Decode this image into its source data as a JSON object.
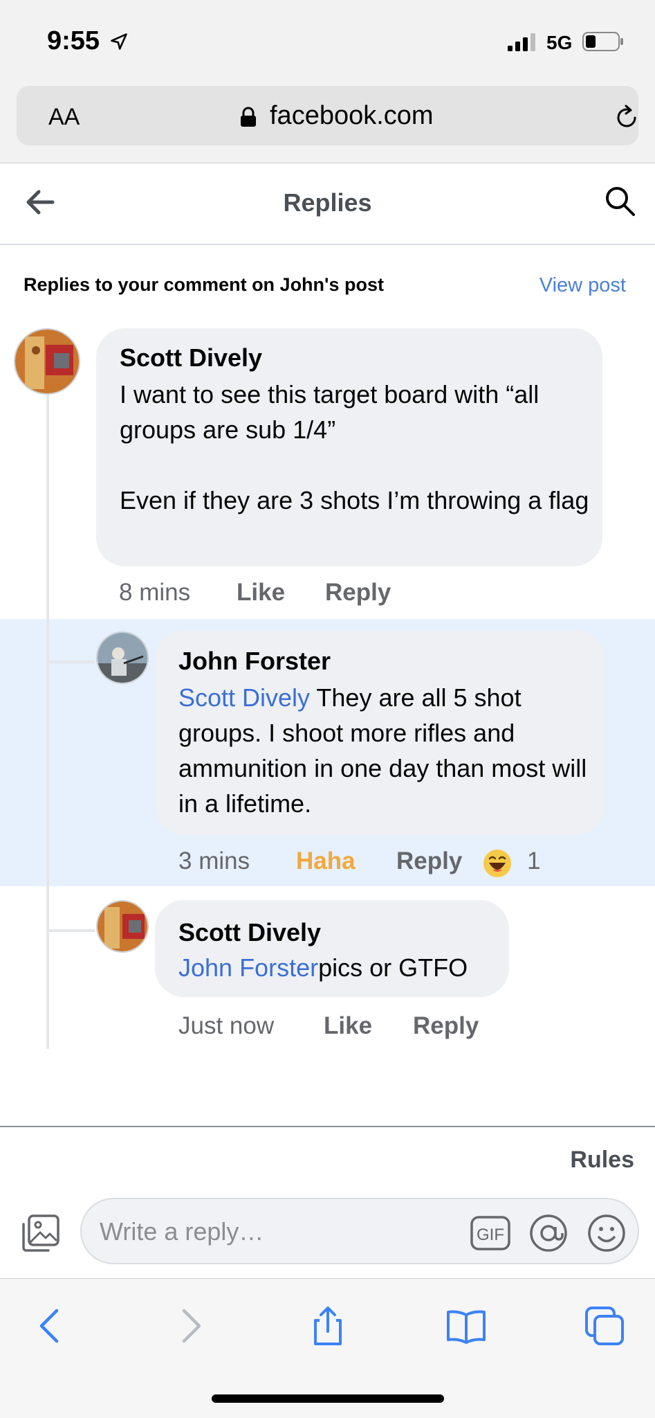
{
  "status_bar": {
    "time": "9:55",
    "network": "5G"
  },
  "browser": {
    "text_size_label": "AA",
    "url": "facebook.com"
  },
  "header": {
    "title": "Replies"
  },
  "subheader": {
    "text": "Replies to your comment on John's post",
    "view_post": "View post"
  },
  "comments": [
    {
      "author": "Scott Dively",
      "text": "I want to see this target board with “all groups are sub 1/4”\n\nEven if they are 3 shots I’m throwing a flag",
      "time": "8 mins",
      "like_label": "Like",
      "reply_label": "Reply"
    },
    {
      "author": "John Forster",
      "mention": "Scott Dively",
      "text": " They are all 5 shot groups. I shoot more rifles and ammunition in one day than most will in a lifetime.",
      "time": "3 mins",
      "reaction_label": "Haha",
      "reply_label": "Reply",
      "reaction_count": "1",
      "reaction_emoji": "haha-emoji"
    },
    {
      "author": "Scott Dively",
      "mention": "John Forster",
      "text": "pics or GTFO",
      "time": "Just now",
      "like_label": "Like",
      "reply_label": "Reply"
    }
  ],
  "footer": {
    "rules_label": "Rules",
    "reply_placeholder": "Write a reply…",
    "gif_label": "GIF"
  },
  "colors": {
    "link": "#3b6fd4",
    "highlight": "#e7f0fd",
    "haha": "#f2a93b",
    "bubble": "#eef0f3"
  }
}
